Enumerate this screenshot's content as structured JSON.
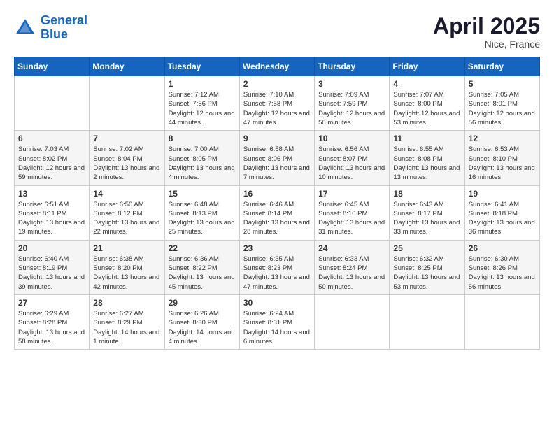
{
  "header": {
    "logo_line1": "General",
    "logo_line2": "Blue",
    "month": "April 2025",
    "location": "Nice, France"
  },
  "weekdays": [
    "Sunday",
    "Monday",
    "Tuesday",
    "Wednesday",
    "Thursday",
    "Friday",
    "Saturday"
  ],
  "weeks": [
    [
      {
        "day": "",
        "sunrise": "",
        "sunset": "",
        "daylight": ""
      },
      {
        "day": "",
        "sunrise": "",
        "sunset": "",
        "daylight": ""
      },
      {
        "day": "1",
        "sunrise": "Sunrise: 7:12 AM",
        "sunset": "Sunset: 7:56 PM",
        "daylight": "Daylight: 12 hours and 44 minutes."
      },
      {
        "day": "2",
        "sunrise": "Sunrise: 7:10 AM",
        "sunset": "Sunset: 7:58 PM",
        "daylight": "Daylight: 12 hours and 47 minutes."
      },
      {
        "day": "3",
        "sunrise": "Sunrise: 7:09 AM",
        "sunset": "Sunset: 7:59 PM",
        "daylight": "Daylight: 12 hours and 50 minutes."
      },
      {
        "day": "4",
        "sunrise": "Sunrise: 7:07 AM",
        "sunset": "Sunset: 8:00 PM",
        "daylight": "Daylight: 12 hours and 53 minutes."
      },
      {
        "day": "5",
        "sunrise": "Sunrise: 7:05 AM",
        "sunset": "Sunset: 8:01 PM",
        "daylight": "Daylight: 12 hours and 56 minutes."
      }
    ],
    [
      {
        "day": "6",
        "sunrise": "Sunrise: 7:03 AM",
        "sunset": "Sunset: 8:02 PM",
        "daylight": "Daylight: 12 hours and 59 minutes."
      },
      {
        "day": "7",
        "sunrise": "Sunrise: 7:02 AM",
        "sunset": "Sunset: 8:04 PM",
        "daylight": "Daylight: 13 hours and 2 minutes."
      },
      {
        "day": "8",
        "sunrise": "Sunrise: 7:00 AM",
        "sunset": "Sunset: 8:05 PM",
        "daylight": "Daylight: 13 hours and 4 minutes."
      },
      {
        "day": "9",
        "sunrise": "Sunrise: 6:58 AM",
        "sunset": "Sunset: 8:06 PM",
        "daylight": "Daylight: 13 hours and 7 minutes."
      },
      {
        "day": "10",
        "sunrise": "Sunrise: 6:56 AM",
        "sunset": "Sunset: 8:07 PM",
        "daylight": "Daylight: 13 hours and 10 minutes."
      },
      {
        "day": "11",
        "sunrise": "Sunrise: 6:55 AM",
        "sunset": "Sunset: 8:08 PM",
        "daylight": "Daylight: 13 hours and 13 minutes."
      },
      {
        "day": "12",
        "sunrise": "Sunrise: 6:53 AM",
        "sunset": "Sunset: 8:10 PM",
        "daylight": "Daylight: 13 hours and 16 minutes."
      }
    ],
    [
      {
        "day": "13",
        "sunrise": "Sunrise: 6:51 AM",
        "sunset": "Sunset: 8:11 PM",
        "daylight": "Daylight: 13 hours and 19 minutes."
      },
      {
        "day": "14",
        "sunrise": "Sunrise: 6:50 AM",
        "sunset": "Sunset: 8:12 PM",
        "daylight": "Daylight: 13 hours and 22 minutes."
      },
      {
        "day": "15",
        "sunrise": "Sunrise: 6:48 AM",
        "sunset": "Sunset: 8:13 PM",
        "daylight": "Daylight: 13 hours and 25 minutes."
      },
      {
        "day": "16",
        "sunrise": "Sunrise: 6:46 AM",
        "sunset": "Sunset: 8:14 PM",
        "daylight": "Daylight: 13 hours and 28 minutes."
      },
      {
        "day": "17",
        "sunrise": "Sunrise: 6:45 AM",
        "sunset": "Sunset: 8:16 PM",
        "daylight": "Daylight: 13 hours and 31 minutes."
      },
      {
        "day": "18",
        "sunrise": "Sunrise: 6:43 AM",
        "sunset": "Sunset: 8:17 PM",
        "daylight": "Daylight: 13 hours and 33 minutes."
      },
      {
        "day": "19",
        "sunrise": "Sunrise: 6:41 AM",
        "sunset": "Sunset: 8:18 PM",
        "daylight": "Daylight: 13 hours and 36 minutes."
      }
    ],
    [
      {
        "day": "20",
        "sunrise": "Sunrise: 6:40 AM",
        "sunset": "Sunset: 8:19 PM",
        "daylight": "Daylight: 13 hours and 39 minutes."
      },
      {
        "day": "21",
        "sunrise": "Sunrise: 6:38 AM",
        "sunset": "Sunset: 8:20 PM",
        "daylight": "Daylight: 13 hours and 42 minutes."
      },
      {
        "day": "22",
        "sunrise": "Sunrise: 6:36 AM",
        "sunset": "Sunset: 8:22 PM",
        "daylight": "Daylight: 13 hours and 45 minutes."
      },
      {
        "day": "23",
        "sunrise": "Sunrise: 6:35 AM",
        "sunset": "Sunset: 8:23 PM",
        "daylight": "Daylight: 13 hours and 47 minutes."
      },
      {
        "day": "24",
        "sunrise": "Sunrise: 6:33 AM",
        "sunset": "Sunset: 8:24 PM",
        "daylight": "Daylight: 13 hours and 50 minutes."
      },
      {
        "day": "25",
        "sunrise": "Sunrise: 6:32 AM",
        "sunset": "Sunset: 8:25 PM",
        "daylight": "Daylight: 13 hours and 53 minutes."
      },
      {
        "day": "26",
        "sunrise": "Sunrise: 6:30 AM",
        "sunset": "Sunset: 8:26 PM",
        "daylight": "Daylight: 13 hours and 56 minutes."
      }
    ],
    [
      {
        "day": "27",
        "sunrise": "Sunrise: 6:29 AM",
        "sunset": "Sunset: 8:28 PM",
        "daylight": "Daylight: 13 hours and 58 minutes."
      },
      {
        "day": "28",
        "sunrise": "Sunrise: 6:27 AM",
        "sunset": "Sunset: 8:29 PM",
        "daylight": "Daylight: 14 hours and 1 minute."
      },
      {
        "day": "29",
        "sunrise": "Sunrise: 6:26 AM",
        "sunset": "Sunset: 8:30 PM",
        "daylight": "Daylight: 14 hours and 4 minutes."
      },
      {
        "day": "30",
        "sunrise": "Sunrise: 6:24 AM",
        "sunset": "Sunset: 8:31 PM",
        "daylight": "Daylight: 14 hours and 6 minutes."
      },
      {
        "day": "",
        "sunrise": "",
        "sunset": "",
        "daylight": ""
      },
      {
        "day": "",
        "sunrise": "",
        "sunset": "",
        "daylight": ""
      },
      {
        "day": "",
        "sunrise": "",
        "sunset": "",
        "daylight": ""
      }
    ]
  ]
}
